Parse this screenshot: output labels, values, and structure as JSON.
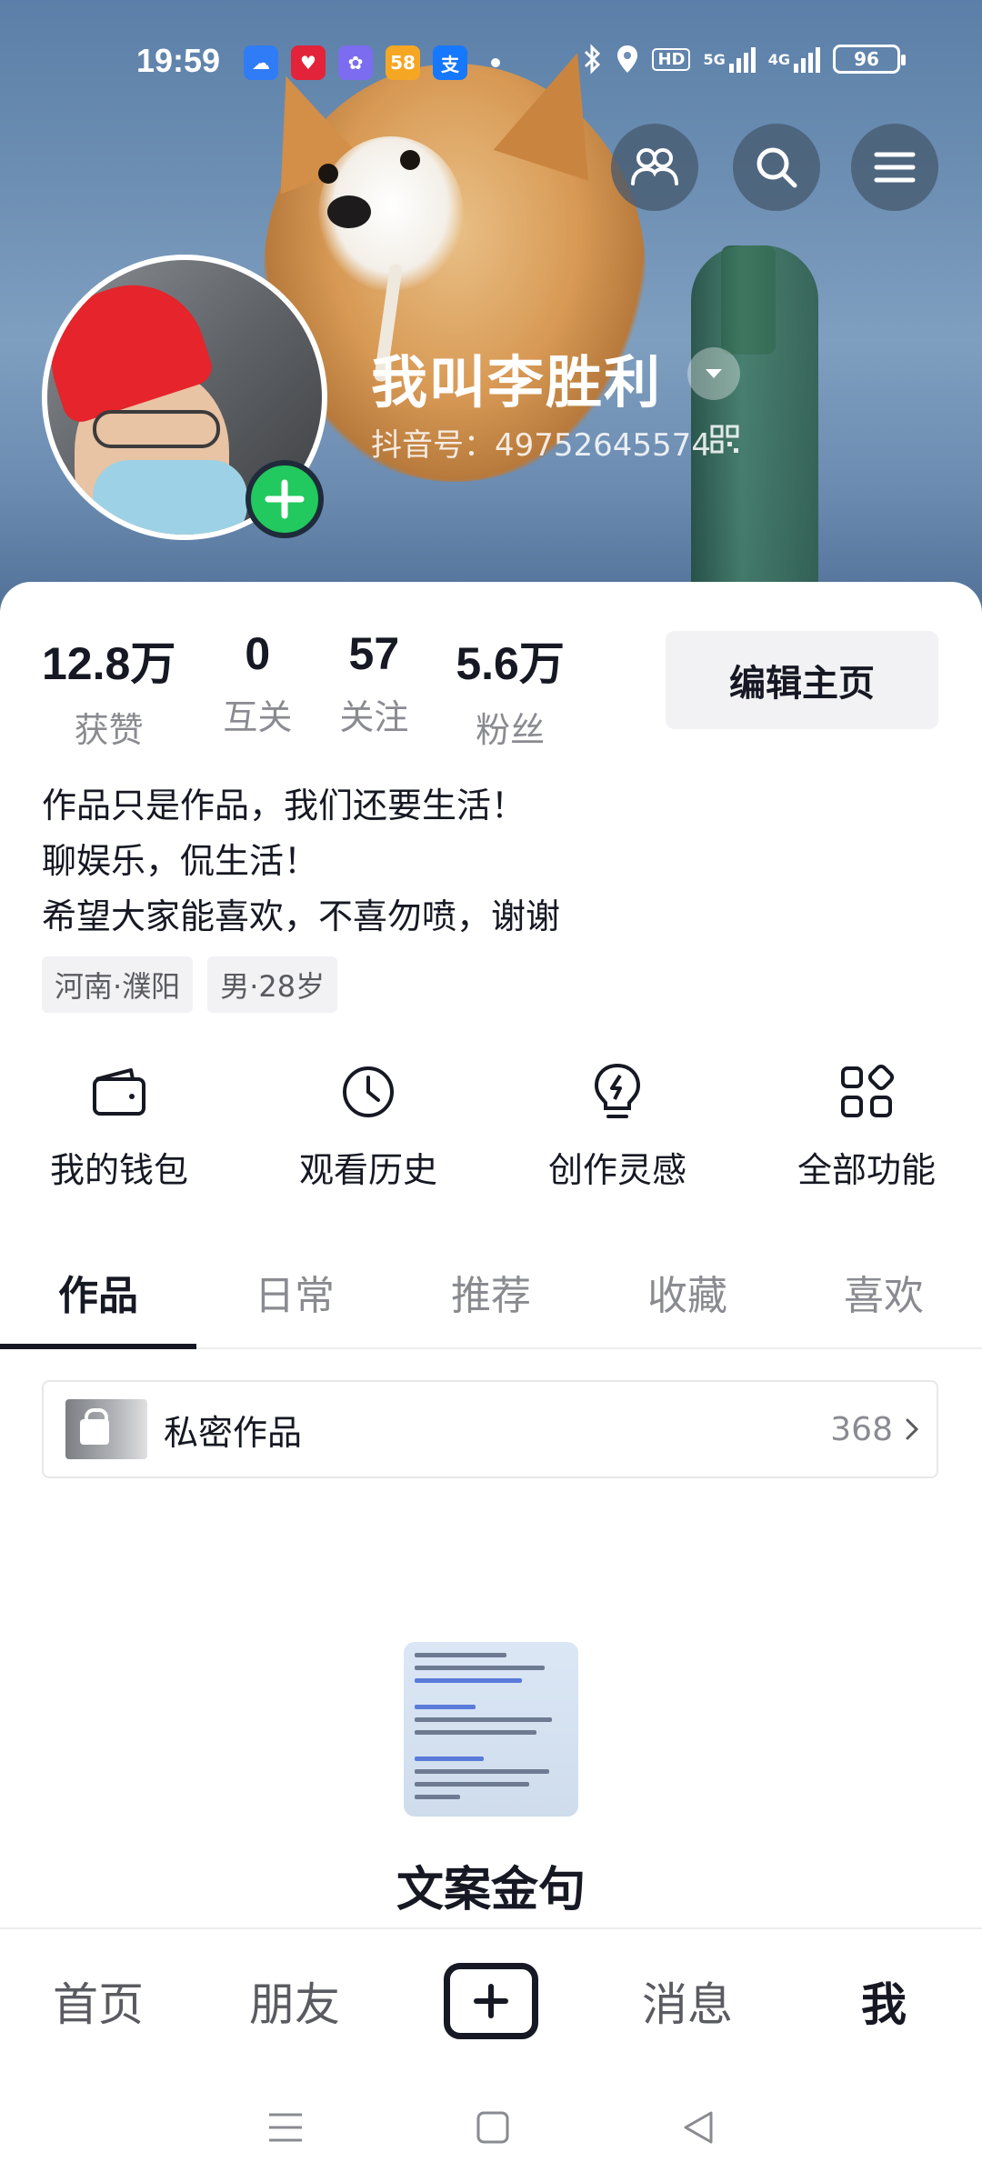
{
  "status_bar": {
    "time": "19:59",
    "app_icons": [
      {
        "name": "cloud-app-icon",
        "glyph": "☁",
        "color": "#2f7cf6"
      },
      {
        "name": "heart-app-icon",
        "glyph": "♥",
        "color": "#e2233a"
      },
      {
        "name": "flower-app-icon",
        "glyph": "✿",
        "color": "#7c6cf0"
      },
      {
        "name": "app-58-icon",
        "glyph": "58",
        "color": "#f5a623"
      },
      {
        "name": "alipay-icon",
        "glyph": "支",
        "color": "#1677ff"
      }
    ],
    "hd": "HD",
    "net1": "5G",
    "net2": "4G",
    "battery": "96"
  },
  "profile": {
    "nickname": "我叫李胜利",
    "douyin_id": "抖音号：49752645574"
  },
  "stats": [
    {
      "num": "12.8万",
      "label": "获赞"
    },
    {
      "num": "0",
      "label": "互关"
    },
    {
      "num": "57",
      "label": "关注"
    },
    {
      "num": "5.6万",
      "label": "粉丝"
    }
  ],
  "edit_button": "编辑主页",
  "bio": [
    "作品只是作品，我们还要生活！",
    "聊娱乐，侃生活！",
    "希望大家能喜欢，不喜勿喷，谢谢"
  ],
  "tags": [
    "河南·濮阳",
    "男·28岁"
  ],
  "functions": [
    {
      "label": "我的钱包",
      "icon": "wallet-icon"
    },
    {
      "label": "观看历史",
      "icon": "clock-icon"
    },
    {
      "label": "创作灵感",
      "icon": "lightbulb-icon"
    },
    {
      "label": "全部功能",
      "icon": "grid-icon"
    }
  ],
  "tabs": [
    "作品",
    "日常",
    "推荐",
    "收藏",
    "喜欢"
  ],
  "active_tab": "作品",
  "private_works": {
    "label": "私密作品",
    "count": "368"
  },
  "card": {
    "title": "文案金句"
  },
  "bottom_nav": {
    "home": "首页",
    "friends": "朋友",
    "messages": "消息",
    "me": "我"
  }
}
